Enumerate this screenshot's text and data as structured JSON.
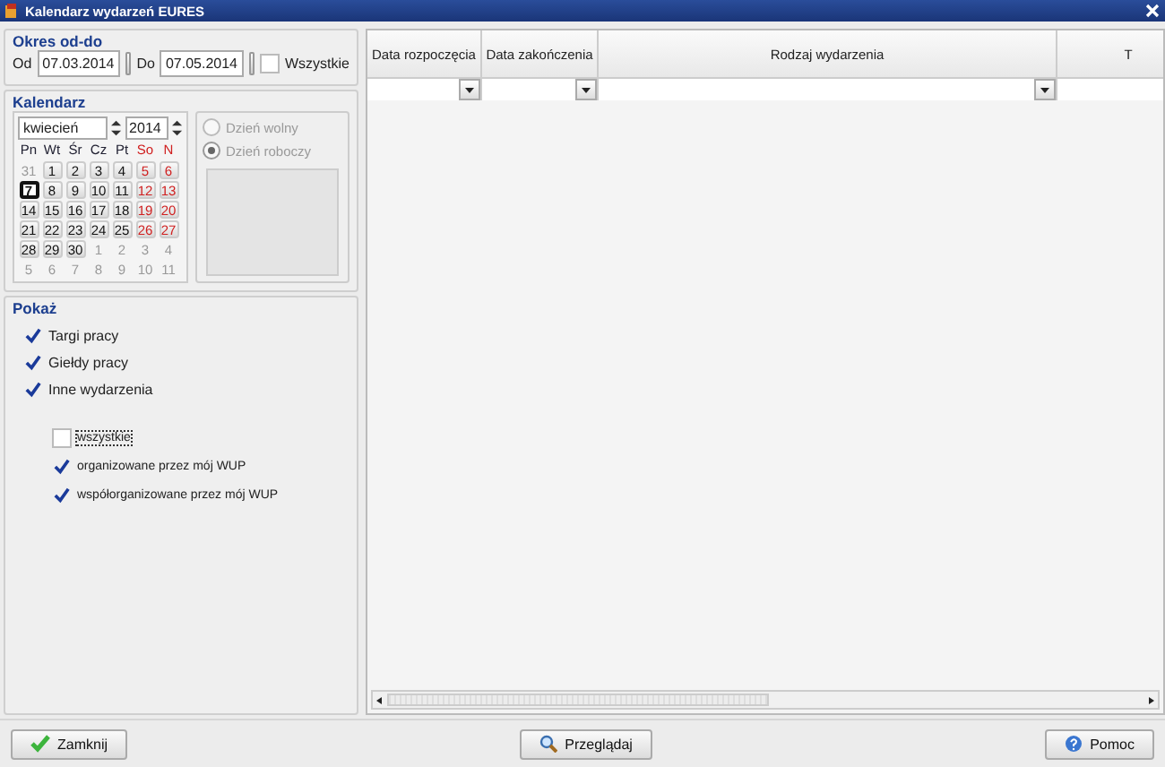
{
  "window": {
    "title": "Kalendarz wydarzeń EURES"
  },
  "period": {
    "title": "Okres od-do",
    "from_label": "Od",
    "from": "07.03.2014",
    "to_label": "Do",
    "to": "07.05.2014",
    "all_label": "Wszystkie",
    "all_checked": false
  },
  "calendar": {
    "title": "Kalendarz",
    "month": "kwiecień",
    "year": "2014",
    "weekdays": [
      {
        "label": "Pn",
        "kind": "normal"
      },
      {
        "label": "Wt",
        "kind": "normal"
      },
      {
        "label": "Śr",
        "kind": "normal"
      },
      {
        "label": "Cz",
        "kind": "normal"
      },
      {
        "label": "Pt",
        "kind": "normal"
      },
      {
        "label": "So",
        "kind": "weekend"
      },
      {
        "label": "N",
        "kind": "weekend"
      }
    ],
    "weeks": [
      [
        {
          "day": "31",
          "kind": "other",
          "selected": false
        },
        {
          "day": "1",
          "kind": "normal",
          "selected": false
        },
        {
          "day": "2",
          "kind": "normal",
          "selected": false
        },
        {
          "day": "3",
          "kind": "normal",
          "selected": false
        },
        {
          "day": "4",
          "kind": "normal",
          "selected": false
        },
        {
          "day": "5",
          "kind": "weekend",
          "selected": false
        },
        {
          "day": "6",
          "kind": "weekend",
          "selected": false
        }
      ],
      [
        {
          "day": "7",
          "kind": "normal",
          "selected": true
        },
        {
          "day": "8",
          "kind": "normal",
          "selected": false
        },
        {
          "day": "9",
          "kind": "normal",
          "selected": false
        },
        {
          "day": "10",
          "kind": "normal",
          "selected": false
        },
        {
          "day": "11",
          "kind": "normal",
          "selected": false
        },
        {
          "day": "12",
          "kind": "weekend",
          "selected": false
        },
        {
          "day": "13",
          "kind": "weekend",
          "selected": false
        }
      ],
      [
        {
          "day": "14",
          "kind": "normal",
          "selected": false
        },
        {
          "day": "15",
          "kind": "normal",
          "selected": false
        },
        {
          "day": "16",
          "kind": "normal",
          "selected": false
        },
        {
          "day": "17",
          "kind": "normal",
          "selected": false
        },
        {
          "day": "18",
          "kind": "normal",
          "selected": false
        },
        {
          "day": "19",
          "kind": "weekend",
          "selected": false
        },
        {
          "day": "20",
          "kind": "weekend",
          "selected": false
        }
      ],
      [
        {
          "day": "21",
          "kind": "normal",
          "selected": false
        },
        {
          "day": "22",
          "kind": "normal",
          "selected": false
        },
        {
          "day": "23",
          "kind": "normal",
          "selected": false
        },
        {
          "day": "24",
          "kind": "normal",
          "selected": false
        },
        {
          "day": "25",
          "kind": "normal",
          "selected": false
        },
        {
          "day": "26",
          "kind": "weekend",
          "selected": false
        },
        {
          "day": "27",
          "kind": "weekend",
          "selected": false
        }
      ],
      [
        {
          "day": "28",
          "kind": "normal",
          "selected": false
        },
        {
          "day": "29",
          "kind": "normal",
          "selected": false
        },
        {
          "day": "30",
          "kind": "normal",
          "selected": false
        },
        {
          "day": "1",
          "kind": "other",
          "selected": false
        },
        {
          "day": "2",
          "kind": "other",
          "selected": false
        },
        {
          "day": "3",
          "kind": "other",
          "selected": false
        },
        {
          "day": "4",
          "kind": "other",
          "selected": false
        }
      ],
      [
        {
          "day": "5",
          "kind": "other",
          "selected": false
        },
        {
          "day": "6",
          "kind": "other",
          "selected": false
        },
        {
          "day": "7",
          "kind": "other",
          "selected": false
        },
        {
          "day": "8",
          "kind": "other",
          "selected": false
        },
        {
          "day": "9",
          "kind": "other",
          "selected": false
        },
        {
          "day": "10",
          "kind": "other",
          "selected": false
        },
        {
          "day": "11",
          "kind": "other",
          "selected": false
        }
      ]
    ],
    "day_types": [
      {
        "label": "Dzień wolny",
        "selected": false,
        "disabled": true
      },
      {
        "label": "Dzień roboczy",
        "selected": true,
        "disabled": true
      }
    ]
  },
  "show": {
    "title": "Pokaż",
    "types": [
      {
        "label": "Targi pracy",
        "checked": true
      },
      {
        "label": "Giełdy pracy",
        "checked": true
      },
      {
        "label": "Inne wydarzenia",
        "checked": true
      }
    ],
    "organizers": [
      {
        "label": "wszystkie",
        "checked": false,
        "focused": true
      },
      {
        "label": "organizowane przez mój WUP",
        "checked": true,
        "focused": false
      },
      {
        "label": "współorganizowane przez mój WUP",
        "checked": true,
        "focused": false
      }
    ]
  },
  "table": {
    "columns": [
      {
        "label": "Data rozpoczęcia",
        "kind": "filter"
      },
      {
        "label": "Data zakończenia",
        "kind": "filter"
      },
      {
        "label": "Rodzaj wydarzenia",
        "kind": "filter"
      },
      {
        "label": "T",
        "kind": "cut"
      }
    ]
  },
  "buttons": [
    {
      "label": "Zamknij"
    },
    {
      "label": "Przeglądaj"
    },
    {
      "label": "Pomoc"
    }
  ]
}
